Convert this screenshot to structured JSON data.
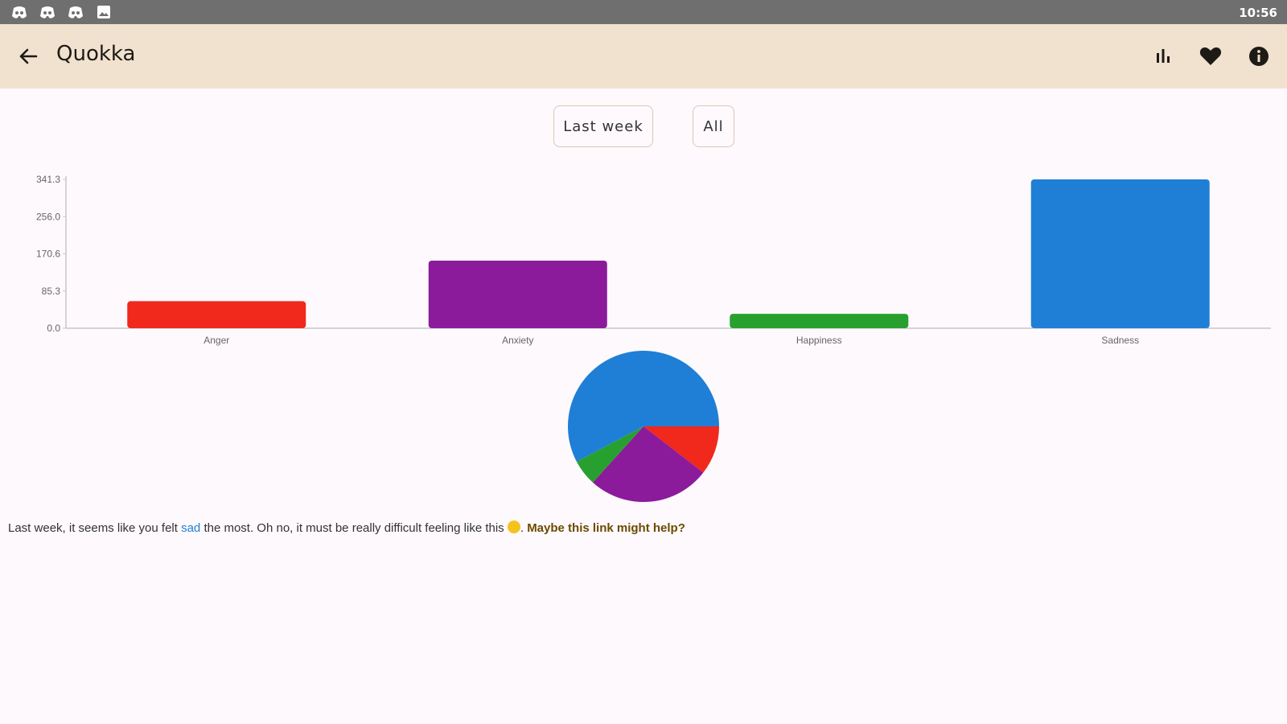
{
  "status_bar": {
    "time": "10:56",
    "notification_icons": [
      "discord-icon",
      "discord-icon",
      "discord-icon",
      "gallery-icon"
    ]
  },
  "app_bar": {
    "title": "Quokka",
    "actions": [
      "bar-chart-icon",
      "heart-icon",
      "info-icon"
    ]
  },
  "range_toggle": {
    "options": [
      "Last week",
      "All"
    ]
  },
  "colors": {
    "background": "#fdf9fc",
    "app_bar": "#f1e1cf",
    "status_bar": "#6f6f6f",
    "anger": "#f0291c",
    "anxiety": "#8b1b9b",
    "happiness": "#27a02f",
    "sadness": "#1f7fd6"
  },
  "chart_data": [
    {
      "type": "bar",
      "categories": [
        "Anger",
        "Anxiety",
        "Happiness",
        "Sadness"
      ],
      "values": [
        62,
        155,
        33,
        341.3
      ],
      "colors": [
        "#f0291c",
        "#8b1b9b",
        "#27a02f",
        "#1f7fd6"
      ],
      "yticks": [
        "0.0",
        "85.3",
        "170.6",
        "256.0",
        "341.3"
      ],
      "ylim": [
        0,
        341.3
      ],
      "title": "",
      "xlabel": "",
      "ylabel": ""
    },
    {
      "type": "pie",
      "categories": [
        "Anger",
        "Anxiety",
        "Happiness",
        "Sadness"
      ],
      "values": [
        62,
        155,
        33,
        341.3
      ],
      "colors": [
        "#f0291c",
        "#8b1b9b",
        "#27a02f",
        "#1f7fd6"
      ]
    }
  ],
  "summary": {
    "prefix": "Last week, it seems like you felt ",
    "emotion": "sad",
    "middle": " the most. Oh no, it must be really difficult feeling like this ",
    "emoji": "worried-face-emoji",
    "separator": ". ",
    "link": "Maybe this link might help?"
  }
}
